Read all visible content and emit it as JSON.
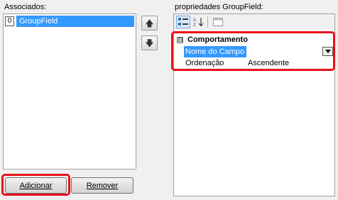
{
  "left_panel": {
    "label": "Associados:",
    "items": [
      {
        "index": "0",
        "name": "GroupField"
      }
    ]
  },
  "buttons": {
    "up": "move-up-arrow",
    "down": "move-down-arrow",
    "add": "Adicionar",
    "remove": "Remover"
  },
  "right_panel": {
    "label": "propriedades GroupField:",
    "toolbar_icons": [
      "categorized-icon",
      "alphabetical-icon",
      "property-pages-icon"
    ],
    "category": {
      "expander": "⊟",
      "name": "Comportamento"
    },
    "properties": [
      {
        "name": "Nome do Campo",
        "value": ""
      },
      {
        "name": "Ordenação",
        "value": "Ascendente"
      }
    ]
  },
  "colors": {
    "selection": "#3399ff",
    "highlight": "#e8101a"
  }
}
